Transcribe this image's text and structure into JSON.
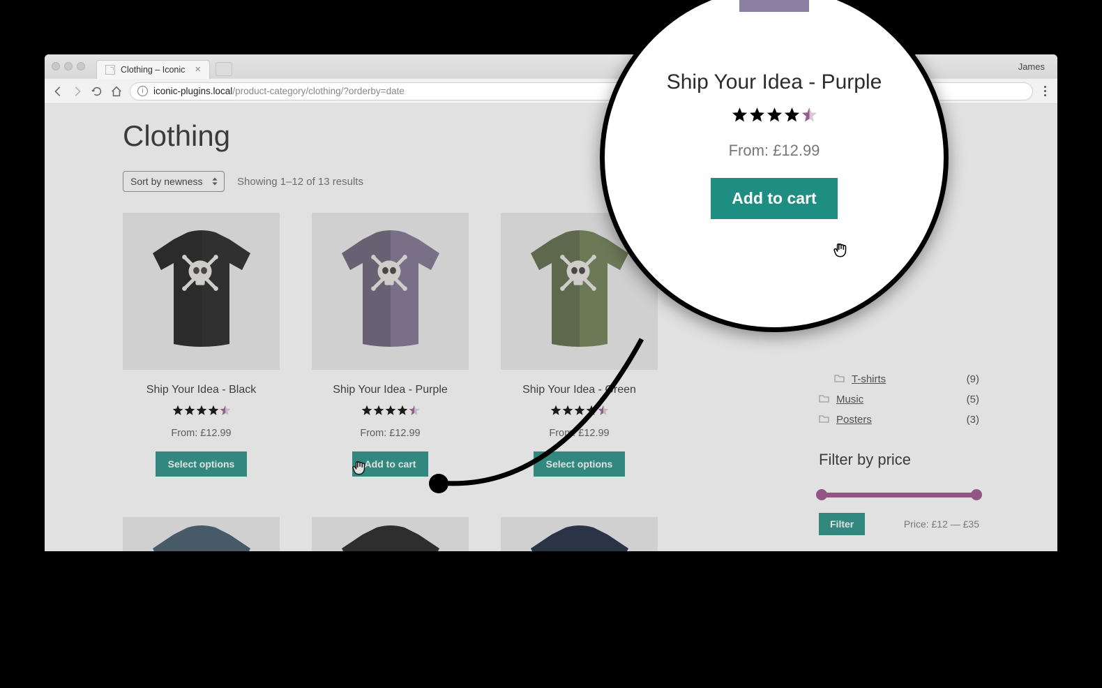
{
  "browser": {
    "tab_title": "Clothing – Iconic",
    "profile_name": "James",
    "url_host": "iconic-plugins.local",
    "url_path": "/product-category/clothing/?orderby=date"
  },
  "page": {
    "title": "Clothing",
    "sort_label": "Sort by newness",
    "results_text": "Showing 1–12 of 13 results"
  },
  "products": [
    {
      "title": "Ship Your Idea - Black",
      "price": "From: £12.99",
      "button": "Select options",
      "color": "#1d1d1d"
    },
    {
      "title": "Ship Your Idea - Purple",
      "price": "From: £12.99",
      "button": "Add to cart",
      "color": "#7a6f8e"
    },
    {
      "title": "Ship Your Idea - Green",
      "price": "From: £12.99",
      "button": "Select options",
      "color": "#6a7a4f"
    }
  ],
  "row2_colors": [
    "#3a5363",
    "#1a1a1a",
    "#16223a"
  ],
  "sidebar": {
    "categories": [
      {
        "label": "T-shirts",
        "count": "(9)",
        "indent": true
      },
      {
        "label": "Music",
        "count": "(5)",
        "indent": false
      },
      {
        "label": "Posters",
        "count": "(3)",
        "indent": false
      }
    ],
    "filter_title": "Filter by price",
    "filter_button": "Filter",
    "range_text": "Price: £12 — £35"
  },
  "magnifier": {
    "title": "Ship Your Idea - Purple",
    "price": "From: £12.99",
    "button": "Add to cart",
    "tee_color": "#8a7fa3"
  }
}
